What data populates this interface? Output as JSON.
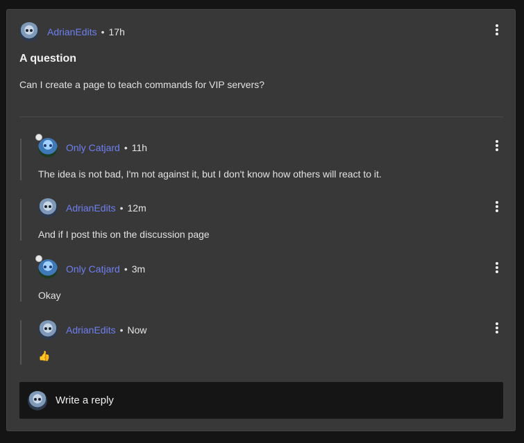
{
  "post": {
    "author": "AdrianEdits",
    "separator": "•",
    "time": "17h",
    "title": "A question",
    "body": "Can I create a page to teach commands for VIP servers?"
  },
  "replies": [
    {
      "author": "Only Catjard",
      "time": "11h",
      "body": "The idea is not bad, I'm not against it, but I don't know how others will react to it."
    },
    {
      "author": "AdrianEdits",
      "time": "12m",
      "body": "And if I post this on the discussion page"
    },
    {
      "author": "Only Catjard",
      "time": "3m",
      "body": "Okay"
    },
    {
      "author": "AdrianEdits",
      "time": "Now",
      "body": "👍"
    }
  ],
  "composer": {
    "placeholder": "Write a reply"
  },
  "icons": {
    "menu": "more-vertical-icon",
    "avatar_user": "avatar-adrianedits",
    "avatar_other": "avatar-onlycatjard"
  },
  "colors": {
    "card_bg": "#383838",
    "page_bg": "#141414",
    "author_link": "#6f7ff0",
    "composer_bg": "#151515"
  }
}
